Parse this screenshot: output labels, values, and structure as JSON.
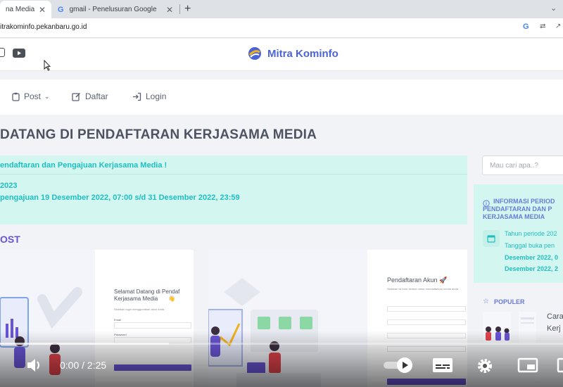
{
  "browser": {
    "tabs": [
      {
        "label": "na Media - \\",
        "active": true
      },
      {
        "label": "gmail - Penelusuran Google",
        "active": false
      }
    ],
    "new_tab": "+",
    "url": "itrakominfo.pekanbaru.go.id"
  },
  "site": {
    "brand": "Mitra Kominfo",
    "nav": [
      {
        "label": "Post",
        "icon": "clipboard-icon"
      },
      {
        "label": "Daftar",
        "icon": "edit-icon"
      },
      {
        "label": "Login",
        "icon": "login-icon"
      }
    ],
    "page_title": "DATANG DI PENDAFTARAN KERJASAMA MEDIA",
    "alert": {
      "headline": "endaftaran dan Pengajuan Kerjasama Media !",
      "line1": "2023",
      "line2": "pengajuan 19 Desember 2022, 07:00 s/d 31 Desember 2022, 23:59"
    },
    "post_heading": "OST",
    "cards": [
      {
        "title": "Selamat Datang di Pendaf\nKerjasama Media",
        "emoji": "👋",
        "subtitle": "Silahkan login menggunakan akun Anda",
        "field1": "Email",
        "field2": "Password"
      },
      {
        "title": "Pendaftaran Akun",
        "emoji": "🚀",
        "subtitle": "Silahkan isi form berikut untuk mendaftarkan media anda"
      }
    ]
  },
  "sidebar": {
    "search_placeholder": "Mau cari apa..?",
    "info_title": [
      "INFORMASI PERIOD",
      "PENDAFTARAN DAN P",
      "KERJASAMA MEDIA"
    ],
    "info_lines": [
      "Tahun periode 202",
      "Tanggal buka pen",
      "Desember 2022, 0",
      "Desember 2022, 2"
    ],
    "populer_title": "POPULER",
    "populer_item": [
      "Cara",
      "Kerj"
    ]
  },
  "video": {
    "time": "0:00 / 2:25",
    "played_fraction": 0.0,
    "buffered_fraction": 0.3
  },
  "colors": {
    "brand": "#4a63d8",
    "accent_purple": "#6a54d6",
    "alert_bg": "#d3f6f1",
    "alert_text": "#1fbfbf"
  }
}
